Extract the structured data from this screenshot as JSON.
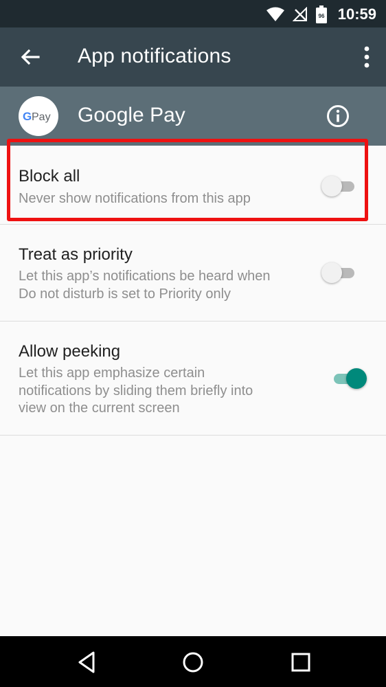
{
  "status_bar": {
    "time": "10:59",
    "icons": [
      "wifi-icon",
      "no-signal-icon",
      "battery-icon"
    ],
    "battery_level": "96"
  },
  "toolbar": {
    "title": "App notifications",
    "back_icon": "arrow-back-icon",
    "menu_icon": "more-vert-icon"
  },
  "app_header": {
    "name": "Google Pay",
    "logo_text": "Pay",
    "logo_letter": "G",
    "info_icon": "info-icon"
  },
  "settings": [
    {
      "title": "Block all",
      "description": "Never show notifications from this app",
      "enabled": false,
      "highlighted": true
    },
    {
      "title": "Treat as priority",
      "description_lines": [
        "Let this app’s notifications be heard when",
        "Do not disturb is set to Priority only"
      ],
      "enabled": false
    },
    {
      "title": "Allow peeking",
      "description_lines": [
        "Let this app emphasize certain",
        "notifications by sliding them briefly into",
        "view on the current screen"
      ],
      "enabled": true
    }
  ],
  "nav_bar": {
    "icons": [
      "nav-back-icon",
      "nav-home-icon",
      "nav-recents-icon"
    ]
  },
  "colors": {
    "status_bar": "#1f2a30",
    "toolbar": "#37464f",
    "app_header": "#5c6e77",
    "switch_on": "#00897b",
    "highlight": "#ee1111"
  }
}
